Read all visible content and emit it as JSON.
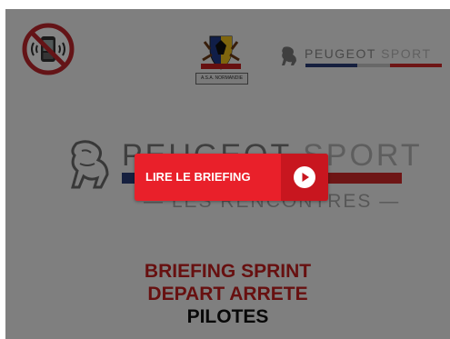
{
  "slide": {
    "club_logo_label": "A.S.A. NORMANDIE",
    "top_brand": {
      "word": "PEUGEOT",
      "sport": "SPORT"
    },
    "center_brand": {
      "word": "PEUGEOT",
      "sport": "SPORT",
      "tagline": "— LES RENCONTRES —"
    },
    "title": {
      "line1": "BRIEFING SPRINT",
      "line2": "DEPART ARRETE",
      "line3": "PILOTES"
    }
  },
  "cta": {
    "label": "LIRE LE BRIEFING",
    "icon": "play-icon"
  },
  "icons": [
    "no-phone-icon",
    "peugeot-lion-icon",
    "club-crest-icon",
    "play-icon"
  ],
  "colors": {
    "overlay": "#000000",
    "cta_bg": "#e9202a",
    "cta_side": "#c8161f",
    "title_red": "#c62020",
    "peugeot_blue": "#2b3f7a",
    "peugeot_red": "#d42a2a"
  }
}
